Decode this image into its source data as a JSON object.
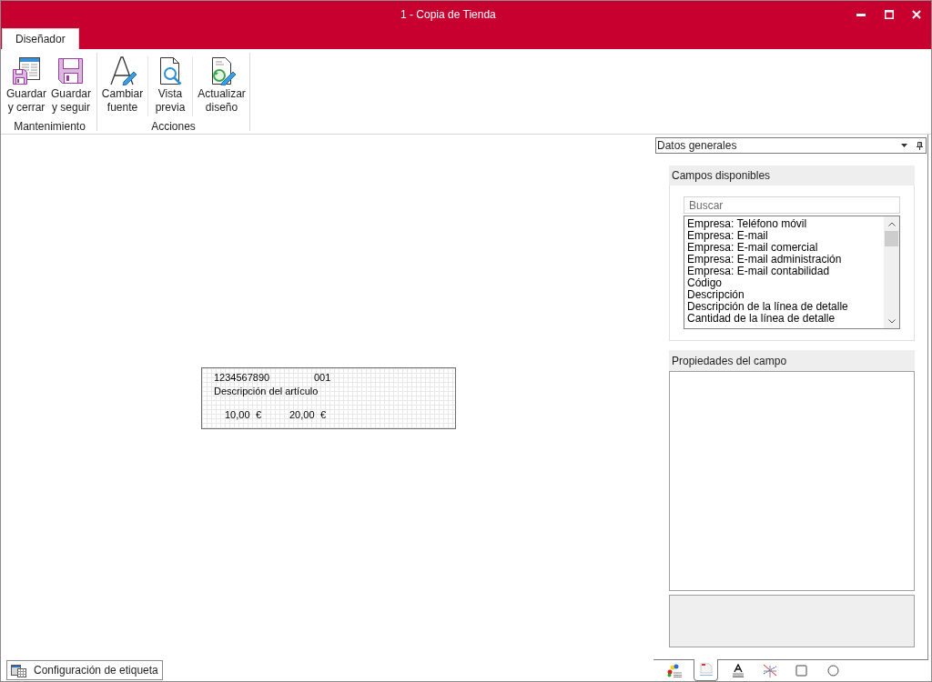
{
  "window": {
    "title": "1 - Copia de Tienda"
  },
  "ribbon": {
    "tabs": [
      {
        "label": "Diseñador",
        "selected": true
      }
    ],
    "groups": [
      {
        "label": "Mantenimiento",
        "buttons": [
          {
            "label_lines": [
              "Guardar",
              "y cerrar"
            ]
          },
          {
            "label_lines": [
              "Guardar",
              "y seguir"
            ]
          }
        ]
      },
      {
        "label": "Acciones",
        "buttons": [
          {
            "label_lines": [
              "Cambiar",
              "fuente"
            ]
          },
          {
            "label_lines": [
              "Vista",
              "previa"
            ]
          },
          {
            "label_lines": [
              "Actualizar",
              "diseño"
            ]
          }
        ]
      }
    ]
  },
  "label_preview": {
    "fields": [
      {
        "text": "1234567890"
      },
      {
        "text": "001"
      },
      {
        "text": "Descripción del artículo"
      },
      {
        "text": "10,00"
      },
      {
        "text": "€"
      },
      {
        "text": "20,00"
      },
      {
        "text": "€"
      }
    ]
  },
  "side_panel": {
    "selector": {
      "value": "Datos generales"
    },
    "available_fields": {
      "title": "Campos disponibles",
      "search": {
        "placeholder": "Buscar"
      },
      "items": [
        {
          "label": "Empresa: Teléfono móvil",
          "selected": false
        },
        {
          "label": "Empresa: E-mail",
          "selected": false
        },
        {
          "label": "Empresa: E-mail comercial",
          "selected": false
        },
        {
          "label": "Empresa: E-mail administración",
          "selected": false
        },
        {
          "label": "Empresa: E-mail contabilidad",
          "selected": false
        },
        {
          "label": "Código",
          "selected": false
        },
        {
          "label": "Descripción",
          "selected": false
        },
        {
          "label": "Descripción de la línea de detalle",
          "selected": false
        },
        {
          "label": "Cantidad de la línea de detalle",
          "selected": false
        }
      ]
    },
    "field_properties": {
      "title": "Propiedades del campo"
    },
    "tool_tabs": [
      {
        "selected": false
      },
      {
        "selected": true
      },
      {
        "selected": false
      },
      {
        "selected": false
      },
      {
        "selected": false
      },
      {
        "selected": false
      }
    ]
  },
  "footer": {
    "button": "Configuración de etiqueta"
  }
}
